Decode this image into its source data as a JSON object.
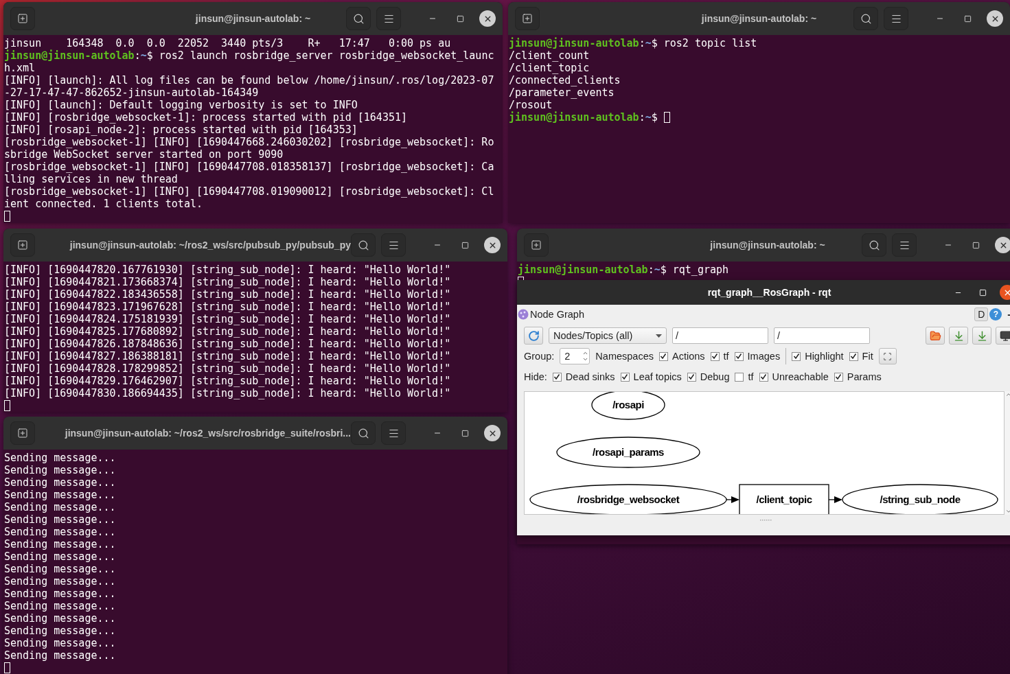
{
  "windows": [
    {
      "title": "jinsun@jinsun-autolab: ~",
      "lines": [
        {
          "kind": "output",
          "text": "jinsun    164348  0.0  0.0  22052  3440 pts/3    R+   17:47   0:00 ps au"
        },
        {
          "kind": "prompt",
          "user": "jinsun@jinsun-autolab",
          "sep": ":",
          "cwd": "~",
          "command": "$ ros2 launch rosbridge_server rosbridge_websocket_launc",
          "cursor": false
        },
        {
          "kind": "output",
          "text": "h.xml"
        },
        {
          "kind": "output",
          "text": "[INFO] [launch]: All log files can be found below /home/jinsun/.ros/log/2023-07"
        },
        {
          "kind": "output",
          "text": "-27-17-47-47-862652-jinsun-autolab-164349"
        },
        {
          "kind": "output",
          "text": "[INFO] [launch]: Default logging verbosity is set to INFO"
        },
        {
          "kind": "output",
          "text": "[INFO] [rosbridge_websocket-1]: process started with pid [164351]"
        },
        {
          "kind": "output",
          "text": "[INFO] [rosapi_node-2]: process started with pid [164353]"
        },
        {
          "kind": "output",
          "text": "[rosbridge_websocket-1] [INFO] [1690447668.246030202] [rosbridge_websocket]: Ro"
        },
        {
          "kind": "output",
          "text": "sbridge WebSocket server started on port 9090"
        },
        {
          "kind": "output",
          "text": "[rosbridge_websocket-1] [INFO] [1690447708.018358137] [rosbridge_websocket]: Ca"
        },
        {
          "kind": "output",
          "text": "lling services in new thread"
        },
        {
          "kind": "output",
          "text": "[rosbridge_websocket-1] [INFO] [1690447708.019090012] [rosbridge_websocket]: Cl"
        },
        {
          "kind": "output",
          "text": "ient connected. 1 clients total."
        },
        {
          "kind": "cursor"
        }
      ]
    },
    {
      "title": "jinsun@jinsun-autolab: ~",
      "lines": [
        {
          "kind": "prompt",
          "user": "jinsun@jinsun-autolab",
          "sep": ":",
          "cwd": "~",
          "command": "$ ros2 topic list",
          "cursor": false
        },
        {
          "kind": "output",
          "text": "/client_count"
        },
        {
          "kind": "output",
          "text": "/client_topic"
        },
        {
          "kind": "output",
          "text": "/connected_clients"
        },
        {
          "kind": "output",
          "text": "/parameter_events"
        },
        {
          "kind": "output",
          "text": "/rosout"
        },
        {
          "kind": "prompt",
          "user": "jinsun@jinsun-autolab",
          "sep": ":",
          "cwd": "~",
          "command": "$ ",
          "cursor": true
        }
      ]
    },
    {
      "title": "jinsun@jinsun-autolab: ~/ros2_ws/src/pubsub_py/pubsub_py",
      "lines": [
        {
          "kind": "output",
          "text": "[INFO] [1690447820.167761930] [string_sub_node]: I heard: \"Hello World!\""
        },
        {
          "kind": "output",
          "text": "[INFO] [1690447821.173668374] [string_sub_node]: I heard: \"Hello World!\""
        },
        {
          "kind": "output",
          "text": "[INFO] [1690447822.183436558] [string_sub_node]: I heard: \"Hello World!\""
        },
        {
          "kind": "output",
          "text": "[INFO] [1690447823.171967628] [string_sub_node]: I heard: \"Hello World!\""
        },
        {
          "kind": "output",
          "text": "[INFO] [1690447824.175181939] [string_sub_node]: I heard: \"Hello World!\""
        },
        {
          "kind": "output",
          "text": "[INFO] [1690447825.177680892] [string_sub_node]: I heard: \"Hello World!\""
        },
        {
          "kind": "output",
          "text": "[INFO] [1690447826.187848636] [string_sub_node]: I heard: \"Hello World!\""
        },
        {
          "kind": "output",
          "text": "[INFO] [1690447827.186388181] [string_sub_node]: I heard: \"Hello World!\""
        },
        {
          "kind": "output",
          "text": "[INFO] [1690447828.178299852] [string_sub_node]: I heard: \"Hello World!\""
        },
        {
          "kind": "output",
          "text": "[INFO] [1690447829.176462907] [string_sub_node]: I heard: \"Hello World!\""
        },
        {
          "kind": "output",
          "text": "[INFO] [1690447830.186694435] [string_sub_node]: I heard: \"Hello World!\""
        },
        {
          "kind": "cursor"
        }
      ]
    },
    {
      "title": "jinsun@jinsun-autolab: ~/ros2_ws/src/rosbridge_suite/rosbri...",
      "lines": [
        {
          "kind": "output",
          "text": "Sending message..."
        },
        {
          "kind": "output",
          "text": "Sending message..."
        },
        {
          "kind": "output",
          "text": "Sending message..."
        },
        {
          "kind": "output",
          "text": "Sending message..."
        },
        {
          "kind": "output",
          "text": "Sending message..."
        },
        {
          "kind": "output",
          "text": "Sending message..."
        },
        {
          "kind": "output",
          "text": "Sending message..."
        },
        {
          "kind": "output",
          "text": "Sending message..."
        },
        {
          "kind": "output",
          "text": "Sending message..."
        },
        {
          "kind": "output",
          "text": "Sending message..."
        },
        {
          "kind": "output",
          "text": "Sending message..."
        },
        {
          "kind": "output",
          "text": "Sending message..."
        },
        {
          "kind": "output",
          "text": "Sending message..."
        },
        {
          "kind": "output",
          "text": "Sending message..."
        },
        {
          "kind": "output",
          "text": "Sending message..."
        },
        {
          "kind": "output",
          "text": "Sending message..."
        },
        {
          "kind": "output",
          "text": "Sending message..."
        },
        {
          "kind": "cursor"
        }
      ]
    },
    {
      "title": "jinsun@jinsun-autolab: ~",
      "lines": [
        {
          "kind": "prompt",
          "user": "jinsun@jinsun-autolab",
          "sep": ":",
          "cwd": "~",
          "command": "$ rqt_graph",
          "cursor": false
        },
        {
          "kind": "cursor"
        }
      ]
    }
  ],
  "rqt": {
    "title": "rqt_graph__RosGraph - rqt",
    "plugin_title": "Node Graph",
    "help_button": "D",
    "about_button": "?",
    "close_button": "-",
    "graph_type": "Nodes/Topics (all)",
    "filters": [
      {
        "value": "/"
      },
      {
        "value": "/"
      }
    ],
    "group": {
      "label": "Group:",
      "value": "2",
      "suffix": "Namespaces"
    },
    "options": [
      {
        "label": "Actions",
        "checked": true
      },
      {
        "label": "tf",
        "checked": true
      },
      {
        "label": "Images",
        "checked": true
      }
    ],
    "view_options": [
      {
        "label": "Highlight",
        "checked": true
      },
      {
        "label": "Fit",
        "checked": true
      }
    ],
    "hide": {
      "label": "Hide:",
      "options": [
        {
          "label": "Dead sinks",
          "checked": true
        },
        {
          "label": "Leaf topics",
          "checked": true
        },
        {
          "label": "Debug",
          "checked": true
        },
        {
          "label": "tf",
          "checked": false
        },
        {
          "label": "Unreachable",
          "checked": true
        },
        {
          "label": "Params",
          "checked": true
        }
      ]
    },
    "graph": {
      "nodes": [
        {
          "label": "/rosapi",
          "kind": "node"
        },
        {
          "label": "/rosapi_params",
          "kind": "node"
        },
        {
          "label": "/rosbridge_websocket",
          "kind": "node"
        },
        {
          "label": "/client_topic",
          "kind": "topic"
        },
        {
          "label": "/string_sub_node",
          "kind": "node"
        }
      ]
    }
  }
}
